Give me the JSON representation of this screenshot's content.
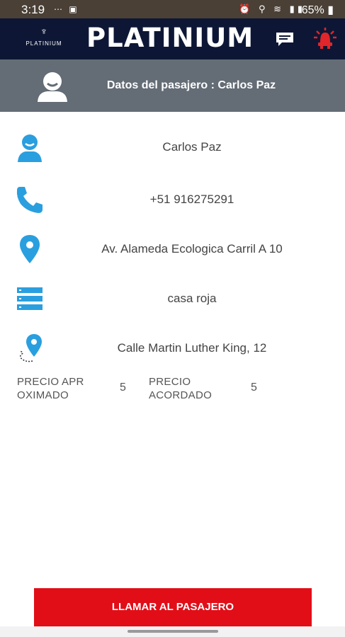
{
  "status_bar": {
    "time": "3:19",
    "battery": "65%"
  },
  "header": {
    "logo_text": "PLATINIUM",
    "brand": "PLATINIUM"
  },
  "passenger_band": {
    "title": "Datos del pasajero : Carlos Paz"
  },
  "rows": [
    {
      "icon": "person-icon",
      "text": "Carlos Paz"
    },
    {
      "icon": "phone-icon",
      "text": "+51 916275291"
    },
    {
      "icon": "location-pin-icon",
      "text": "Av. Alameda Ecologica Carril A 10"
    },
    {
      "icon": "list-icon",
      "text": "casa roja"
    },
    {
      "icon": "destination-route-icon",
      "text": "Calle Martin Luther King, 12"
    }
  ],
  "prices": {
    "approx_label_line1": "PRECIO APR",
    "approx_label_line2": "OXIMADO",
    "approx_value": "5",
    "agreed_label_line1": "PRECIO",
    "agreed_label_line2": "ACORDADO",
    "agreed_value": "5"
  },
  "call_button": {
    "label": "LLAMAR AL PASAJERO"
  },
  "colors": {
    "header_bg": "#0d1735",
    "band_bg": "#646c75",
    "icon_blue": "#2a9fdf",
    "button_red": "#e10e18",
    "alarm_red": "#e0262a"
  }
}
